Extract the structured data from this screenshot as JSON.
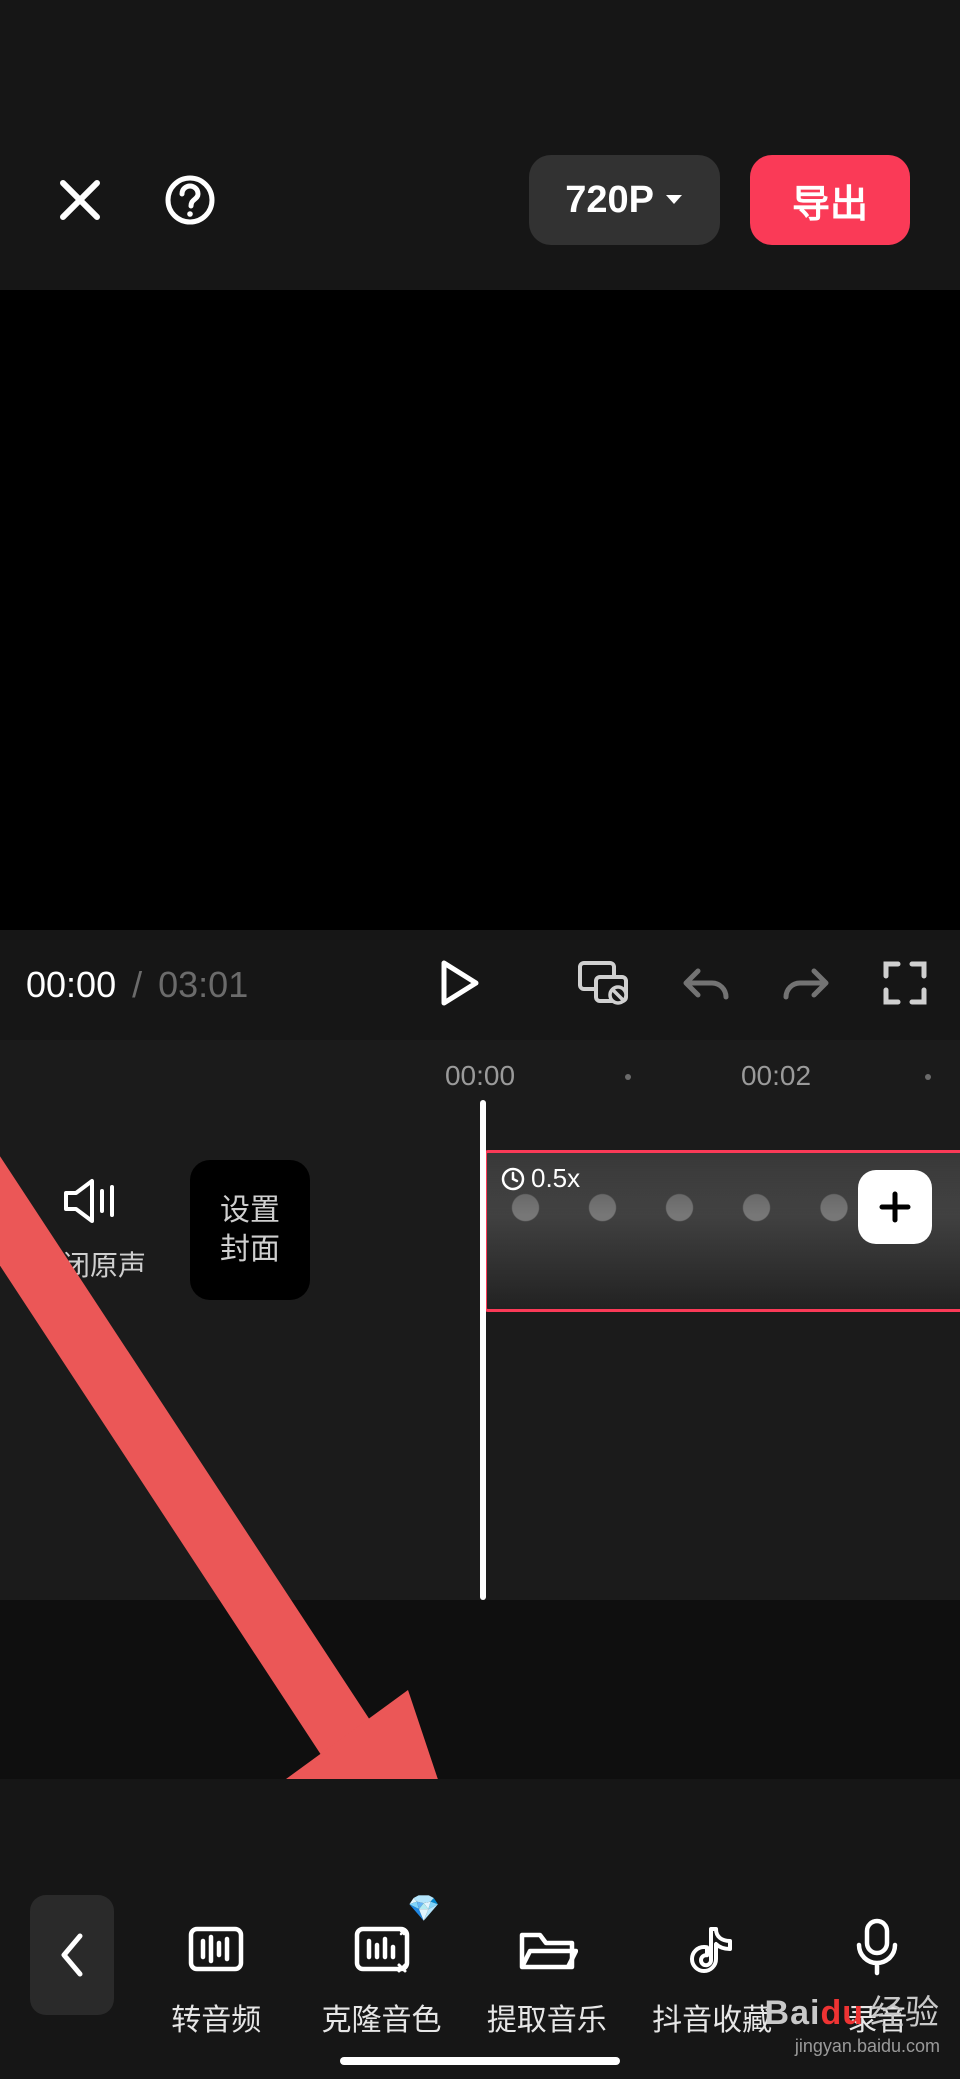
{
  "header": {
    "resolution_label": "720P",
    "export_label": "导出"
  },
  "transport": {
    "current_time": "00:00",
    "separator": "/",
    "duration": "03:01"
  },
  "timeline": {
    "ruler_labels": [
      "00:00",
      "00:02"
    ],
    "mute_label": "关闭原声",
    "cover_line1": "设置",
    "cover_line2": "封面",
    "clip_speed_label": "0.5x"
  },
  "toolbar": {
    "items": [
      {
        "label": "转音频"
      },
      {
        "label": "克隆音色"
      },
      {
        "label": "提取音乐"
      },
      {
        "label": "抖音收藏"
      },
      {
        "label": "录音"
      }
    ]
  },
  "watermark": {
    "brand_prefix": "Bai",
    "brand_accent": "du",
    "brand_suffix": "经验",
    "url": "jingyan.baidu.com"
  }
}
